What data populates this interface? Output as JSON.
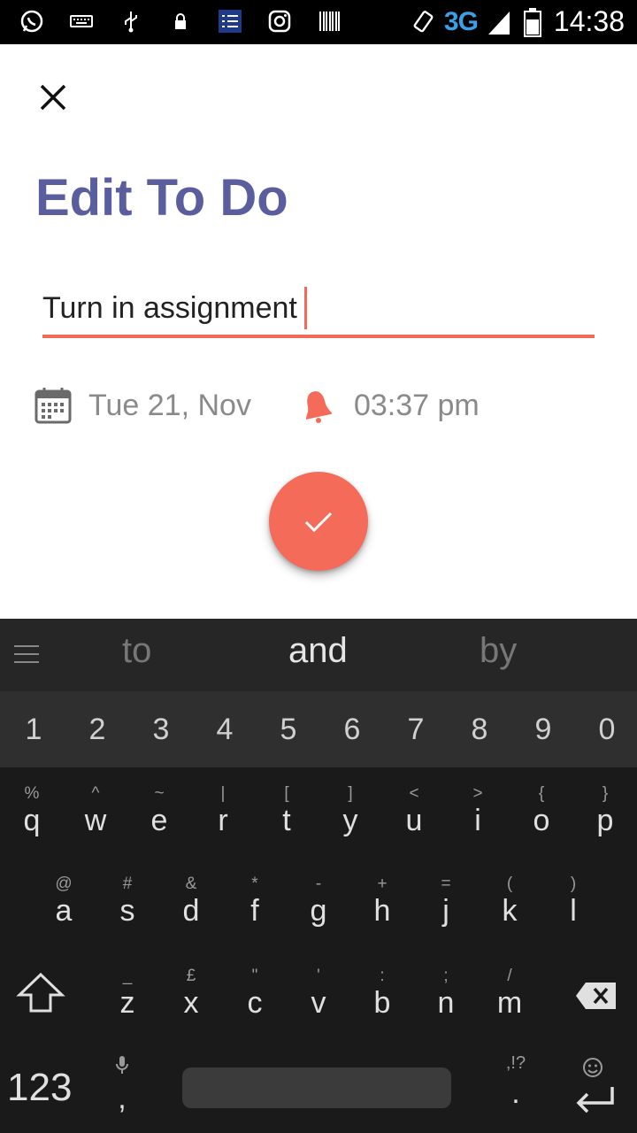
{
  "status_bar": {
    "time": "14:38",
    "network": "3G",
    "left_icons": [
      "whatsapp-icon",
      "keyboard-icon",
      "usb-icon",
      "lock-icon",
      "checklist-icon",
      "instagram-icon",
      "barcode-icon"
    ],
    "right_icons": [
      "rotate-icon",
      "signal-icon",
      "battery-icon"
    ]
  },
  "page": {
    "title": "Edit To Do"
  },
  "todo": {
    "title_value": "Turn in assignment",
    "date": "Tue 21, Nov",
    "time": "03:37 pm"
  },
  "colors": {
    "accent": "#f56b59",
    "title": "#5a5e9e",
    "muted_text": "#8a8a8a"
  },
  "keyboard": {
    "suggestions": [
      "to",
      "and",
      "by"
    ],
    "numbers": [
      "1",
      "2",
      "3",
      "4",
      "5",
      "6",
      "7",
      "8",
      "9",
      "0"
    ],
    "row1": [
      {
        "key": "q",
        "hint": "%"
      },
      {
        "key": "w",
        "hint": "^"
      },
      {
        "key": "e",
        "hint": "~"
      },
      {
        "key": "r",
        "hint": "|"
      },
      {
        "key": "t",
        "hint": "["
      },
      {
        "key": "y",
        "hint": "]"
      },
      {
        "key": "u",
        "hint": "<"
      },
      {
        "key": "i",
        "hint": ">"
      },
      {
        "key": "o",
        "hint": "{"
      },
      {
        "key": "p",
        "hint": "}"
      }
    ],
    "row2": [
      {
        "key": "a",
        "hint": "@"
      },
      {
        "key": "s",
        "hint": "#"
      },
      {
        "key": "d",
        "hint": "&"
      },
      {
        "key": "f",
        "hint": "*"
      },
      {
        "key": "g",
        "hint": "-"
      },
      {
        "key": "h",
        "hint": "+"
      },
      {
        "key": "j",
        "hint": "="
      },
      {
        "key": "k",
        "hint": "("
      },
      {
        "key": "l",
        "hint": ")"
      }
    ],
    "row3": [
      {
        "key": "z",
        "hint": "_"
      },
      {
        "key": "x",
        "hint": "£"
      },
      {
        "key": "c",
        "hint": "\""
      },
      {
        "key": "v",
        "hint": "'"
      },
      {
        "key": "b",
        "hint": ":"
      },
      {
        "key": "n",
        "hint": ";"
      },
      {
        "key": "m",
        "hint": "/"
      }
    ],
    "num_toggle": "123",
    "comma": ",",
    "period": ".",
    "period_hint": ",!?"
  }
}
